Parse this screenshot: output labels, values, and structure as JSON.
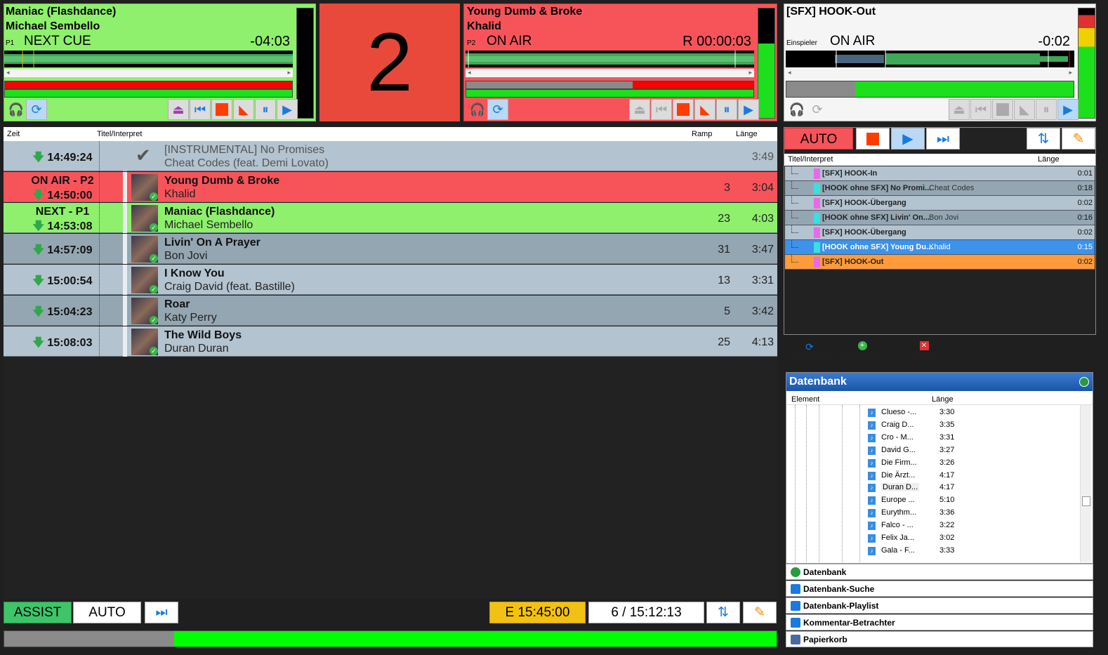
{
  "player1": {
    "title": "Maniac (Flashdance)",
    "artist": "Michael Sembello",
    "deck": "P1",
    "status": "NEXT CUE",
    "time": "-04:03",
    "bg": "#8ef06c",
    "progress": 0.0
  },
  "countdown": {
    "value": "2",
    "bg": "#e8493a"
  },
  "player2": {
    "title": "Young Dumb & Broke",
    "artist": "Khalid",
    "deck": "P2",
    "status": "ON AIR",
    "time": "R 00:00:03",
    "bg": "#f7545a",
    "progress": 0.58
  },
  "player3": {
    "title": "[SFX] HOOK-Out",
    "deck": "Einspieler",
    "status": "ON AIR",
    "time": "-0:02",
    "bg": "#f5f5f5",
    "progress": 0.24
  },
  "playlist": {
    "headers": {
      "time": "Zeit",
      "title": "Titel/Interpret",
      "ramp": "Ramp",
      "length": "Länge"
    },
    "rows": [
      {
        "state": "",
        "time": "14:49:24",
        "title": "[INSTRUMENTAL] No Promises",
        "artist": "Cheat Codes (feat. Demi Lovato)",
        "ramp": "",
        "length": "3:49",
        "bg": "#b3c3cf",
        "played": true
      },
      {
        "state": "ON AIR - P2",
        "time": "14:50:00",
        "title": "Young Dumb & Broke",
        "artist": "Khalid",
        "ramp": "3",
        "length": "3:04",
        "bg": "#f7545a",
        "played": false
      },
      {
        "state": "NEXT - P1",
        "time": "14:53:08",
        "title": "Maniac (Flashdance)",
        "artist": "Michael Sembello",
        "ramp": "23",
        "length": "4:03",
        "bg": "#8ef06c",
        "played": false
      },
      {
        "state": "",
        "time": "14:57:09",
        "title": "Livin' On A Prayer",
        "artist": "Bon Jovi",
        "ramp": "31",
        "length": "3:47",
        "bg": "#94a6b2",
        "played": false
      },
      {
        "state": "",
        "time": "15:00:54",
        "title": "I Know You",
        "artist": "Craig David (feat. Bastille)",
        "ramp": "13",
        "length": "3:31",
        "bg": "#b3c3cf",
        "played": false
      },
      {
        "state": "",
        "time": "15:04:23",
        "title": "Roar",
        "artist": "Katy Perry",
        "ramp": "5",
        "length": "3:42",
        "bg": "#94a6b2",
        "played": false
      },
      {
        "state": "",
        "time": "15:08:03",
        "title": "The Wild Boys",
        "artist": "Duran Duran",
        "ramp": "25",
        "length": "4:13",
        "bg": "#b3c3cf",
        "played": false
      }
    ]
  },
  "bottom": {
    "assist": "ASSIST",
    "auto": "AUTO",
    "end_label": "E  15:45:00",
    "count": "6 / 15:12:13",
    "progress": 0.23
  },
  "right": {
    "auto": "AUTO",
    "headers": {
      "title": "Titel/Interpret",
      "length": "Länge"
    },
    "items": [
      {
        "title": "[SFX] HOOK-In",
        "artist": "",
        "length": "0:01",
        "marker": "#e86ae8",
        "bg": "#b3c3cf"
      },
      {
        "title": "[HOOK ohne SFX] No Promi...",
        "artist": "Cheat Codes",
        "length": "0:18",
        "marker": "#38e0e0",
        "bg": "#94a6b2"
      },
      {
        "title": "[SFX] HOOK-Übergang",
        "artist": "",
        "length": "0:02",
        "marker": "#e86ae8",
        "bg": "#b3c3cf"
      },
      {
        "title": "[HOOK ohne SFX] Livin' On...",
        "artist": "Bon Jovi",
        "length": "0:16",
        "marker": "#38e0e0",
        "bg": "#94a6b2"
      },
      {
        "title": "[SFX] HOOK-Übergang",
        "artist": "",
        "length": "0:02",
        "marker": "#e86ae8",
        "bg": "#b3c3cf"
      },
      {
        "title": "[HOOK ohne SFX] Young Du...",
        "artist": "Khalid",
        "length": "0:15",
        "marker": "#38e0e0",
        "bg": "#3d92ea"
      },
      {
        "title": "[SFX] HOOK-Out",
        "artist": "",
        "length": "0:02",
        "marker": "#e86ae8",
        "bg": "#ff9b3a"
      }
    ],
    "tools": {
      "refresh": "Aktualisieren",
      "add": "Hinzufügen",
      "close": "Schließen"
    }
  },
  "database": {
    "title": "Datenbank",
    "headers": {
      "element": "Element",
      "length": "Länge"
    },
    "items": [
      {
        "name": "Clueso -...",
        "length": "3:30"
      },
      {
        "name": "Craig D...",
        "length": "3:35"
      },
      {
        "name": "Cro - M...",
        "length": "3:31"
      },
      {
        "name": "David G...",
        "length": "3:27"
      },
      {
        "name": "Die Firm...",
        "length": "3:26"
      },
      {
        "name": "Die Ärzt...",
        "length": "4:17"
      },
      {
        "name": "Duran D...",
        "length": "4:17"
      },
      {
        "name": "Europe ...",
        "length": "5:10"
      },
      {
        "name": "Eurythm...",
        "length": "3:36"
      },
      {
        "name": "Falco - ...",
        "length": "3:22"
      },
      {
        "name": "Felix Ja...",
        "length": "3:02"
      },
      {
        "name": "Gala - F...",
        "length": "3:33"
      }
    ],
    "sections": [
      "Datenbank",
      "Datenbank-Suche",
      "Datenbank-Playlist",
      "Kommentar-Betrachter",
      "Papierkorb"
    ]
  }
}
